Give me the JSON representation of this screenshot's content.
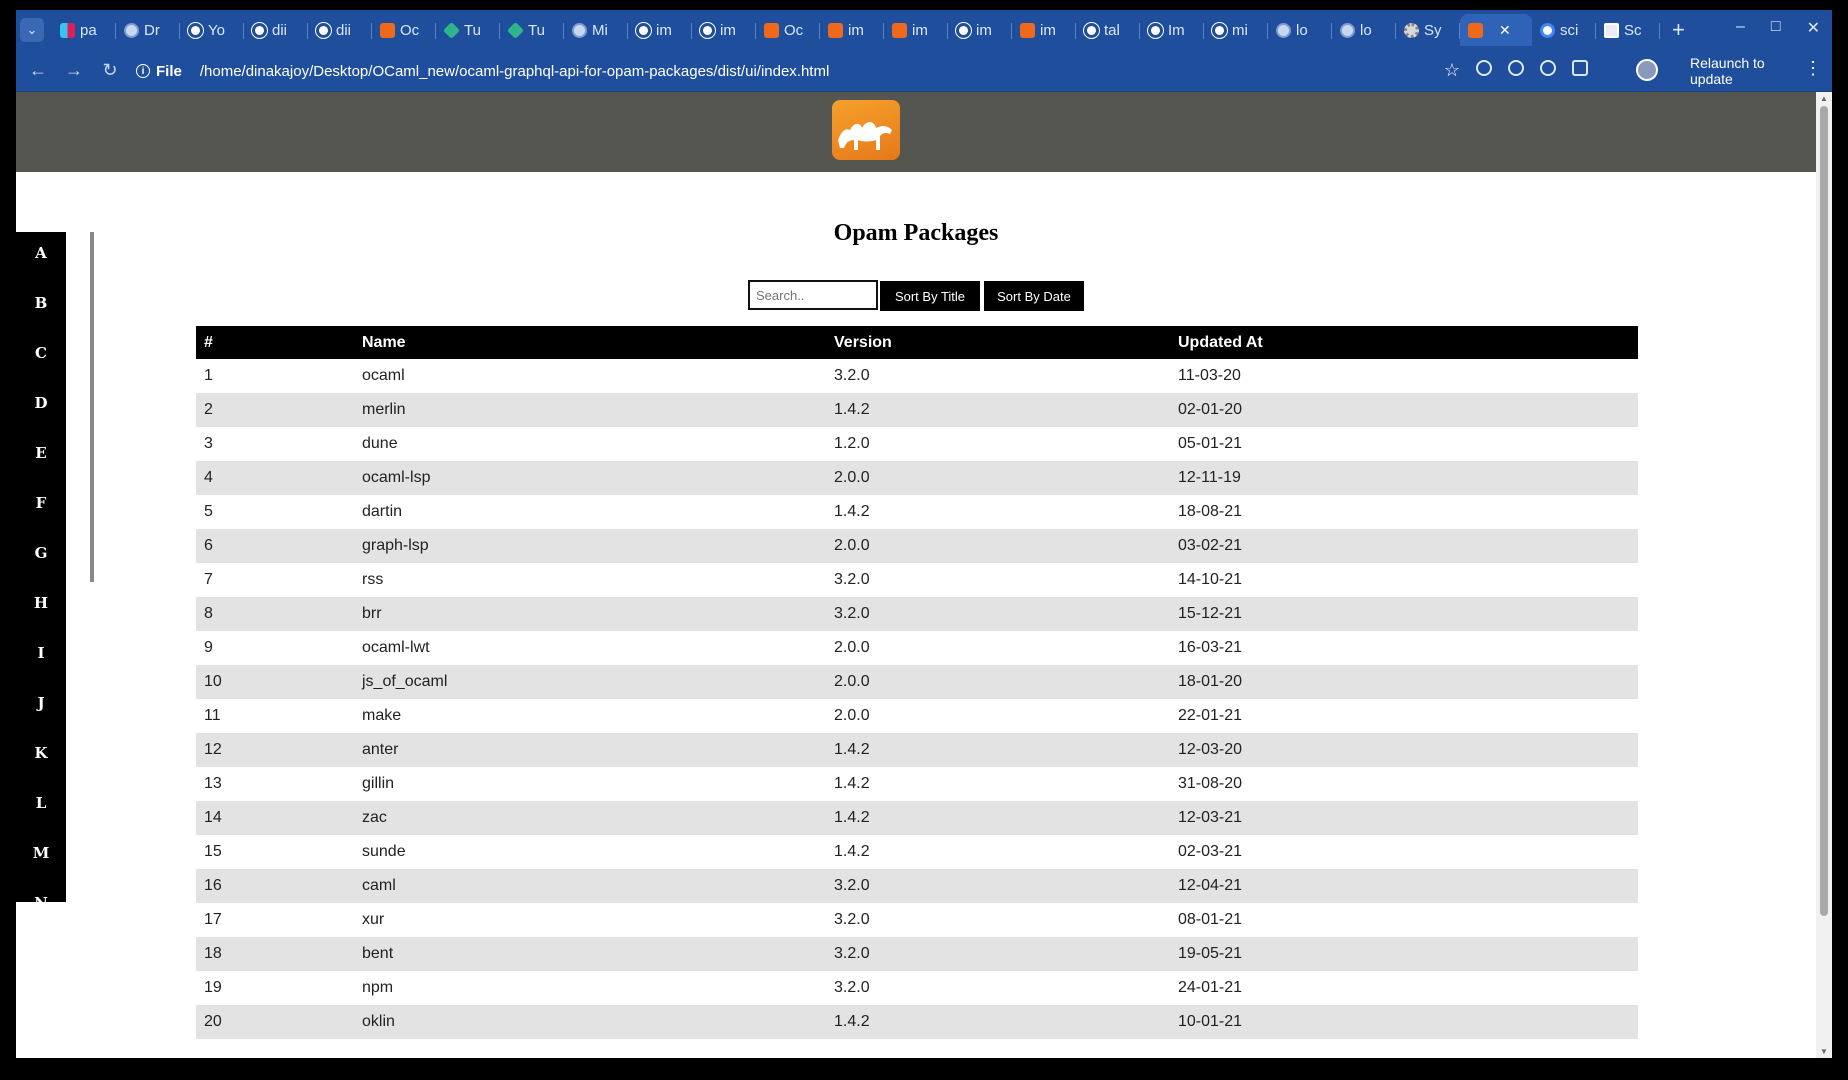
{
  "browser": {
    "tabs": [
      {
        "label": "pa",
        "icon": "slack-icon"
      },
      {
        "label": "Dr",
        "icon": "globe-icon"
      },
      {
        "label": "Yo",
        "icon": "github-icon"
      },
      {
        "label": "dii",
        "icon": "github-icon"
      },
      {
        "label": "dii",
        "icon": "github-icon"
      },
      {
        "label": "Oc",
        "icon": "ocaml-icon"
      },
      {
        "label": "Tu",
        "icon": "green-icon"
      },
      {
        "label": "Tu",
        "icon": "green-icon"
      },
      {
        "label": "Mi",
        "icon": "globe-icon"
      },
      {
        "label": "im",
        "icon": "github-icon"
      },
      {
        "label": "im",
        "icon": "github-icon"
      },
      {
        "label": "Oc",
        "icon": "ocaml-icon"
      },
      {
        "label": "im",
        "icon": "ocaml-icon"
      },
      {
        "label": "im",
        "icon": "ocaml-icon"
      },
      {
        "label": "im",
        "icon": "github-icon"
      },
      {
        "label": "im",
        "icon": "ocaml-icon"
      },
      {
        "label": "tal",
        "icon": "github-icon"
      },
      {
        "label": "Im",
        "icon": "github-icon"
      },
      {
        "label": "mi",
        "icon": "github-icon"
      },
      {
        "label": "lo",
        "icon": "globe-icon"
      },
      {
        "label": "lo",
        "icon": "globe-icon"
      },
      {
        "label": "Sy",
        "icon": "gear-icon"
      },
      {
        "label": "",
        "icon": "ocaml-icon",
        "active": true
      },
      {
        "label": "sci",
        "icon": "google-icon"
      },
      {
        "label": "Sc",
        "icon": "image-icon"
      }
    ],
    "address": {
      "scheme_label": "File",
      "url": "/home/dinakajoy/Desktop/OCaml_new/ocaml-graphql-api-for-opam-packages/dist/ui/index.html"
    },
    "relaunch_label": "Relaunch to update",
    "accent": "#1f4f9c"
  },
  "page": {
    "title": "Opam Packages",
    "search_placeholder": "Search..",
    "sort_title_label": "Sort By Title",
    "sort_date_label": "Sort By Date",
    "sidebar_letters": [
      "A",
      "B",
      "C",
      "D",
      "E",
      "F",
      "G",
      "H",
      "I",
      "J",
      "K",
      "L",
      "M",
      "N"
    ],
    "table": {
      "headers": [
        "#",
        "Name",
        "Version",
        "Updated At"
      ],
      "rows": [
        [
          "1",
          "ocaml",
          "3.2.0",
          "11-03-20"
        ],
        [
          "2",
          "merlin",
          "1.4.2",
          "02-01-20"
        ],
        [
          "3",
          "dune",
          "1.2.0",
          "05-01-21"
        ],
        [
          "4",
          "ocaml-lsp",
          "2.0.0",
          "12-11-19"
        ],
        [
          "5",
          "dartin",
          "1.4.2",
          "18-08-21"
        ],
        [
          "6",
          "graph-lsp",
          "2.0.0",
          "03-02-21"
        ],
        [
          "7",
          "rss",
          "3.2.0",
          "14-10-21"
        ],
        [
          "8",
          "brr",
          "3.2.0",
          "15-12-21"
        ],
        [
          "9",
          "ocaml-lwt",
          "2.0.0",
          "16-03-21"
        ],
        [
          "10",
          "js_of_ocaml",
          "2.0.0",
          "18-01-20"
        ],
        [
          "11",
          "make",
          "2.0.0",
          "22-01-21"
        ],
        [
          "12",
          "anter",
          "1.4.2",
          "12-03-20"
        ],
        [
          "13",
          "gillin",
          "1.4.2",
          "31-08-20"
        ],
        [
          "14",
          "zac",
          "1.4.2",
          "12-03-21"
        ],
        [
          "15",
          "sunde",
          "1.4.2",
          "02-03-21"
        ],
        [
          "16",
          "caml",
          "3.2.0",
          "12-04-21"
        ],
        [
          "17",
          "xur",
          "3.2.0",
          "08-01-21"
        ],
        [
          "18",
          "bent",
          "3.2.0",
          "19-05-21"
        ],
        [
          "19",
          "npm",
          "3.2.0",
          "24-01-21"
        ],
        [
          "20",
          "oklin",
          "1.4.2",
          "10-01-21"
        ]
      ]
    },
    "colors": {
      "header_bar": "#555650",
      "logo": "#ee7a1a",
      "table_header": "#000000",
      "stripe": "#e3e3e3"
    }
  }
}
